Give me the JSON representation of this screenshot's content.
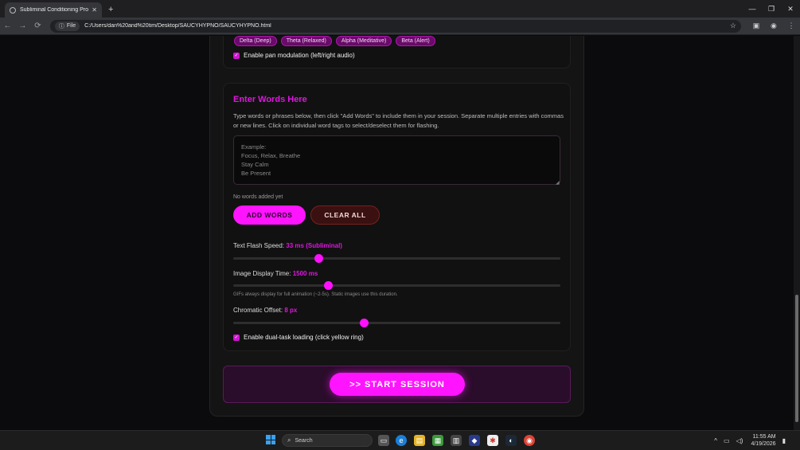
{
  "browser": {
    "tab_title": "Subliminal Conditioning Progr...",
    "new_tab": "+",
    "file_chip": "File",
    "url": "C:/Users/dan%20and%20tim/Desktop/SAUCYHYPNO/SAUCYHYPNO.html",
    "win_minimize": "—",
    "win_restore": "❐",
    "win_close": "✕"
  },
  "wave_presets": [
    "Delta (Deep)",
    "Theta (Relaxed)",
    "Alpha (Meditative)",
    "Beta (Alert)"
  ],
  "pan_modulation_label": "Enable pan modulation (left/right audio)",
  "words_section": {
    "heading": "Enter Words Here",
    "description": "Type words or phrases below, then click \"Add Words\" to include them in your session. Separate multiple entries with commas or new lines. Click on individual word tags to select/deselect them for flashing.",
    "placeholder": "Example:\nFocus, Relax, Breathe\nStay Calm\nBe Present",
    "status": "No words added yet",
    "add_button": "ADD WORDS",
    "clear_button": "CLEAR ALL"
  },
  "sliders": {
    "flash_speed": {
      "label": "Text Flash Speed:",
      "value_text": "33 ms (Subliminal)",
      "fraction": 0.26
    },
    "image_time": {
      "label": "Image Display Time:",
      "value_text": "1500 ms",
      "fraction": 0.29,
      "note": "GIFs always display for full animation (~2-5s). Static images use this duration."
    },
    "chromatic": {
      "label": "Chromatic Offset:",
      "value_text": "8 px",
      "fraction": 0.4
    }
  },
  "dual_task_label": "Enable dual-task loading (click yellow ring)",
  "start_button": ">> START SESSION",
  "taskbar": {
    "search_placeholder": "Search",
    "time": "11:55 AM",
    "date": "4/19/2026"
  },
  "colors": {
    "accent": "#ff14ff",
    "chip_bg": "#6a0a6a",
    "clear_bg": "#3a1010"
  }
}
